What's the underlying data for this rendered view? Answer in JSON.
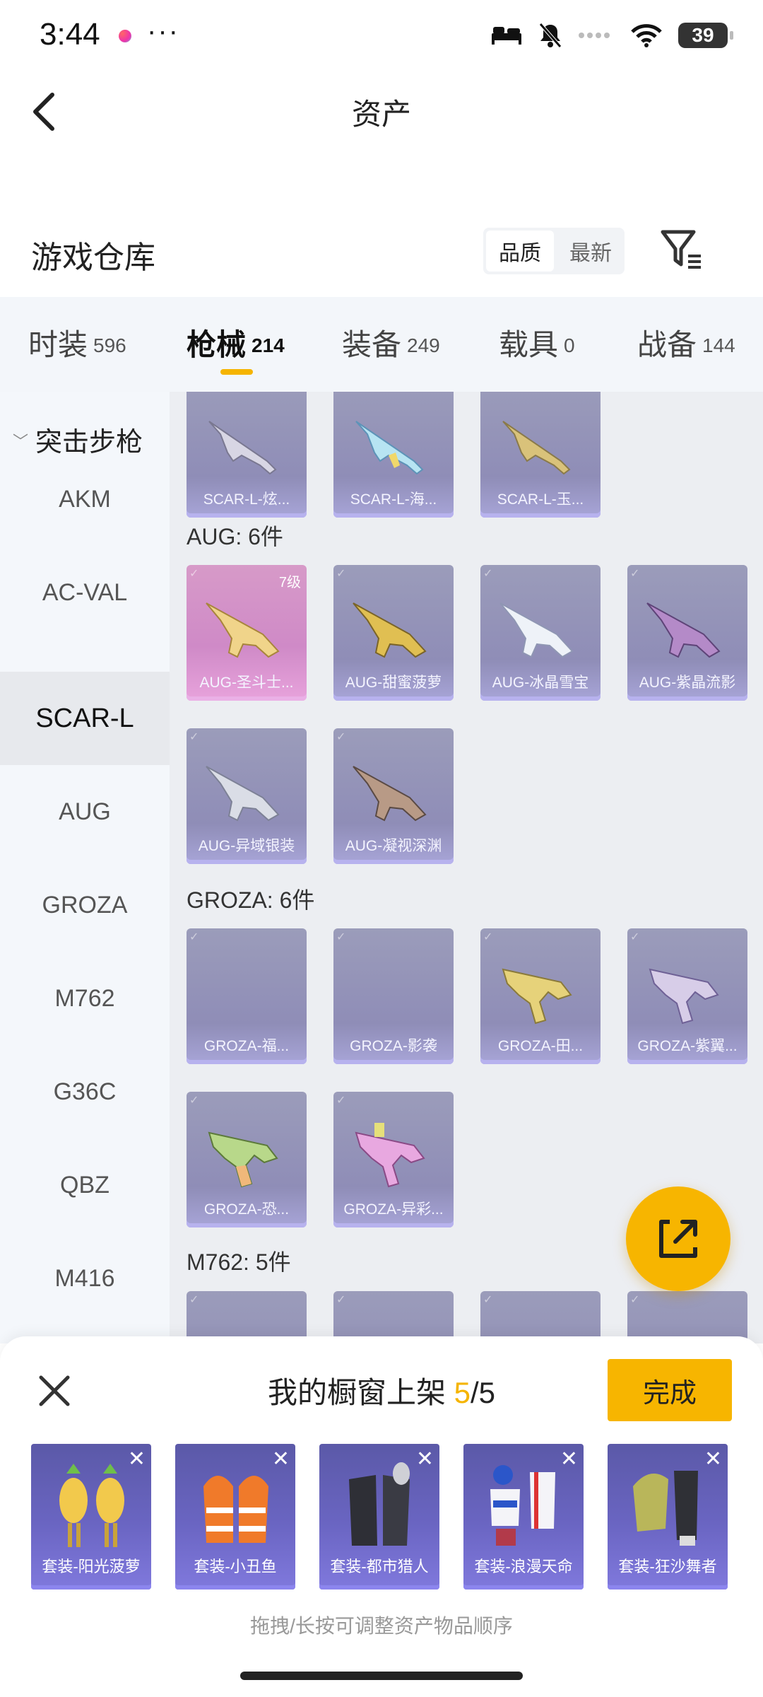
{
  "status": {
    "time": "3:44",
    "more": "···",
    "battery": "39"
  },
  "header": {
    "title": "资产"
  },
  "warehouse": {
    "title": "游戏仓库",
    "sort_quality": "品质",
    "sort_newest": "最新"
  },
  "tabs": [
    {
      "label": "时装",
      "count": "596"
    },
    {
      "label": "枪械",
      "count": "214"
    },
    {
      "label": "装备",
      "count": "249"
    },
    {
      "label": "载具",
      "count": "0"
    },
    {
      "label": "战备",
      "count": "144"
    }
  ],
  "sidebar": {
    "category": "突击步枪",
    "items": [
      "AKM",
      "AC-VAL",
      "SCAR-L",
      "AUG",
      "GROZA",
      "M762",
      "G36C",
      "QBZ",
      "M416"
    ]
  },
  "groups": {
    "scar_items": [
      "SCAR-L-炫...",
      "SCAR-L-海...",
      "SCAR-L-玉..."
    ],
    "aug_title": "AUG: 6件",
    "aug_items": [
      "AUG-圣斗士...",
      "AUG-甜蜜菠萝",
      "AUG-冰晶雪宝",
      "AUG-紫晶流影",
      "AUG-异域银装",
      "AUG-凝视深渊"
    ],
    "aug_level": "7级",
    "groza_title": "GROZA: 6件",
    "groza_items": [
      "GROZA-福...",
      "GROZA-影袭",
      "GROZA-田...",
      "GROZA-紫翼...",
      "GROZA-恐...",
      "GROZA-异彩..."
    ],
    "m762_title": "M762: 5件"
  },
  "panel": {
    "title_prefix": "我的橱窗上架 ",
    "current": "5",
    "total": "/5",
    "done": "完成",
    "items": [
      "套装-阳光菠萝",
      "套装-小丑鱼",
      "套装-都市猎人",
      "套装-浪漫天命",
      "套装-狂沙舞者"
    ],
    "remove": "✕",
    "hint": "拖拽/长按可调整资产物品顺序"
  },
  "colors": {
    "accent": "#f7b500",
    "card": "#9593bd",
    "pink_card": "#d690c8",
    "shelf_card": "#6561bb"
  }
}
